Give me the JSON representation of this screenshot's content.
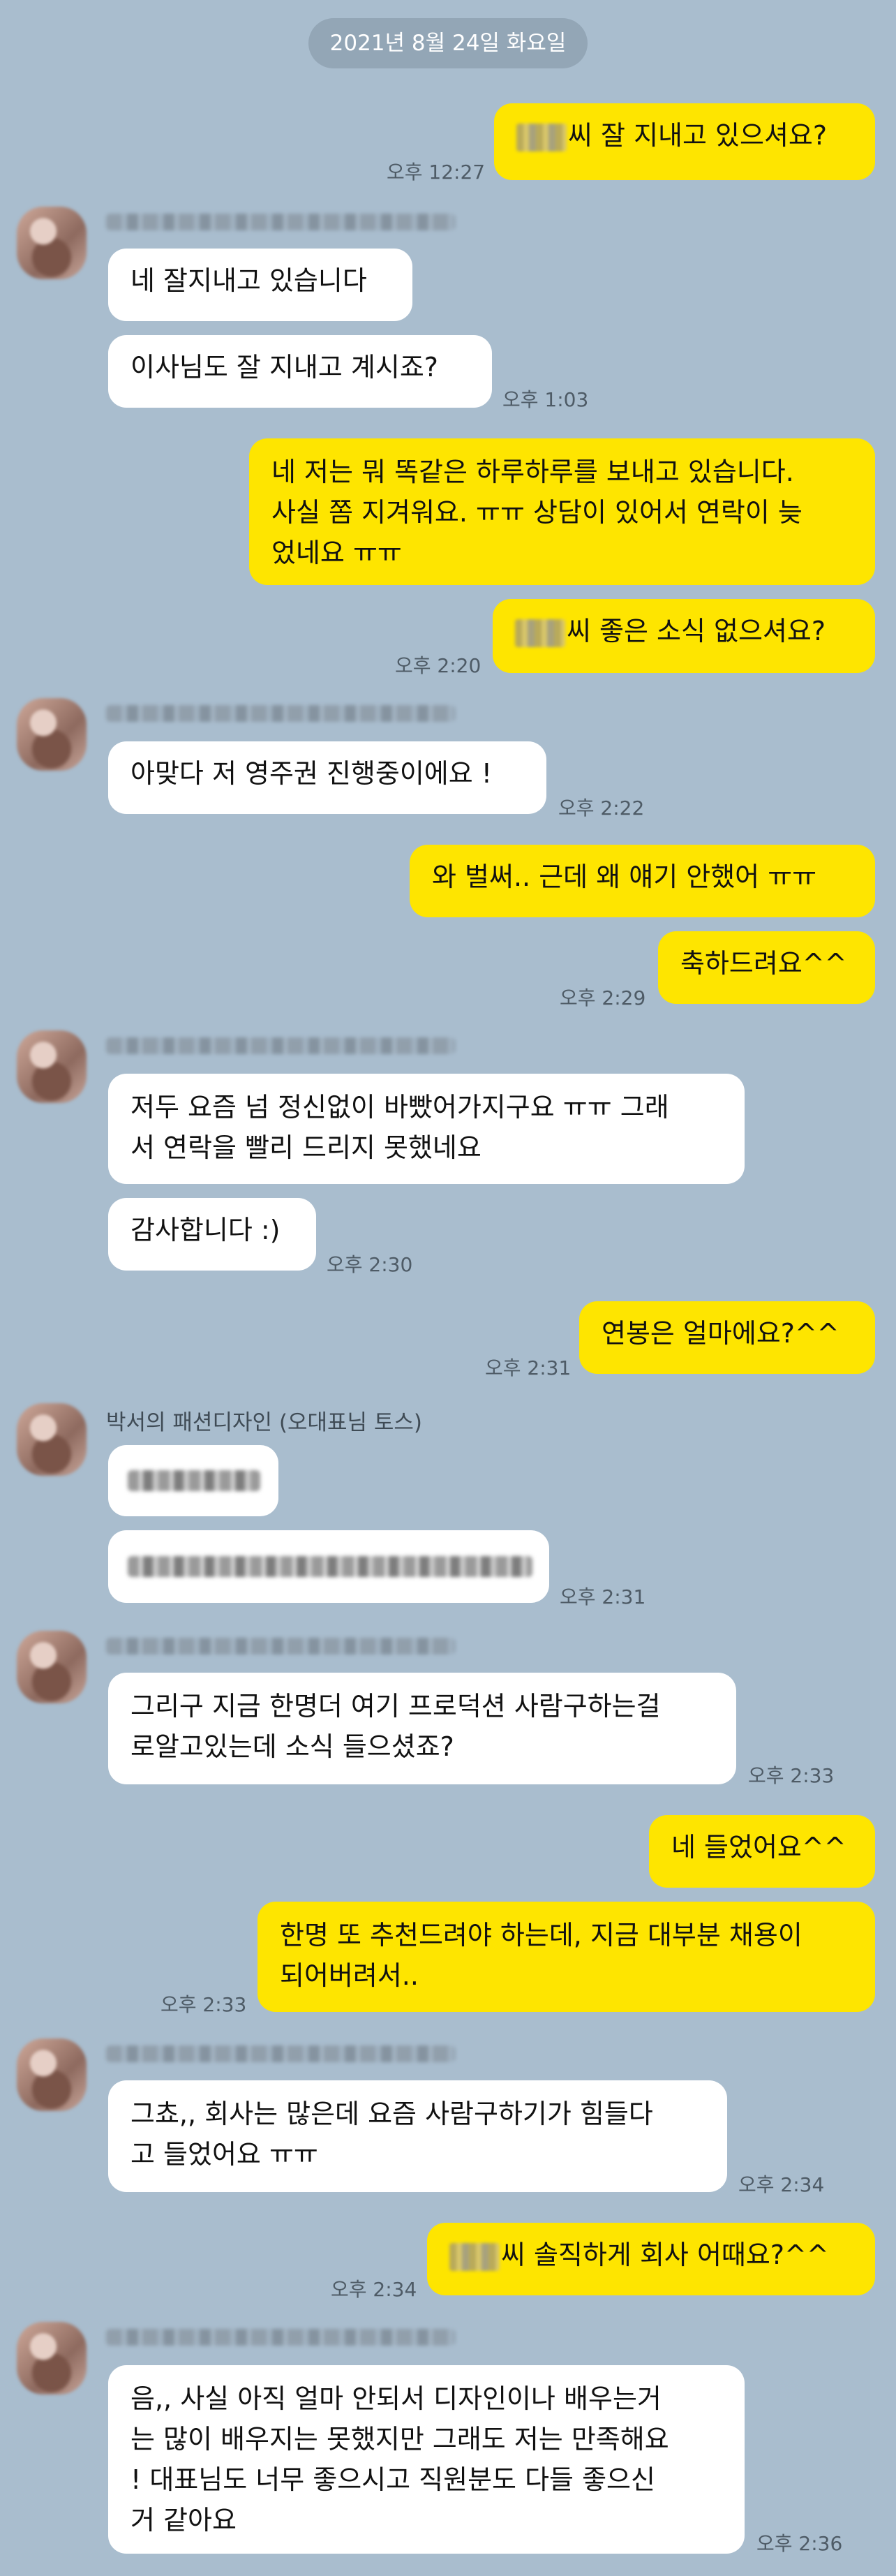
{
  "date_divider": "2021년 8월 24일 화요일",
  "sender_named": "박서의 패션디자인 (오대표님 토스)",
  "messages": {
    "m1": {
      "text": "씨 잘 지내고 있으셔요?",
      "time": "오후 12:27"
    },
    "m2": {
      "text": "네 잘지내고 있습니다"
    },
    "m3": {
      "text": "이사님도 잘 지내고 계시죠?",
      "time": "오후 1:03"
    },
    "m4": {
      "text": "네 저는 뭐 똑같은 하루하루를 보내고 있습니다.\n사실 쫌 지겨워요. ㅠㅠ 상담이 있어서 연락이 늦\n었네요 ㅠㅠ"
    },
    "m5": {
      "text": "씨 좋은 소식 없으셔요?",
      "time": "오후 2:20"
    },
    "m6": {
      "text": "아맞다 저 영주권 진행중이에요 !",
      "time": "오후 2:22"
    },
    "m7": {
      "text": "와 벌써.. 근데 왜 얘기 안했어 ㅠㅠ"
    },
    "m8": {
      "text": "축하드려요^^",
      "time": "오후 2:29"
    },
    "m9": {
      "text": "저두 요즘 넘 정신없이 바빴어가지구요 ㅠㅠ 그래\n서 연락을 빨리 드리지 못했네요"
    },
    "m10": {
      "text": "감사합니다 :)",
      "time": "오후 2:30"
    },
    "m11": {
      "text": "연봉은 얼마에요?^^",
      "time": "오후 2:31"
    },
    "m12": {
      "time": "오후 2:31"
    },
    "m13": {
      "text": "그리구 지금 한명더 여기 프로덕션 사람구하는걸\n로알고있는데 소식 들으셨죠?",
      "time": "오후 2:33"
    },
    "m14": {
      "text": "네 들었어요^^"
    },
    "m15": {
      "text": "한명 또 추천드려야 하는데, 지금 대부분 채용이\n되어버려서..",
      "time": "오후 2:33"
    },
    "m16": {
      "text": "그쵸,, 회사는 많은데 요즘 사람구하기가 힘들다\n고 들었어요 ㅠㅠ",
      "time": "오후 2:34"
    },
    "m17": {
      "text": "씨 솔직하게 회사 어때요?^^",
      "time": "오후 2:34"
    },
    "m18": {
      "text": "음,, 사실 아직 얼마 안되서 디자인이나 배우는거\n는 많이 배우지는 못했지만 그래도 저는 만족해요\n! 대표님도 너무 좋으시고 직원분도 다들 좋으신\n거 같아요",
      "time": "오후 2:36"
    }
  }
}
